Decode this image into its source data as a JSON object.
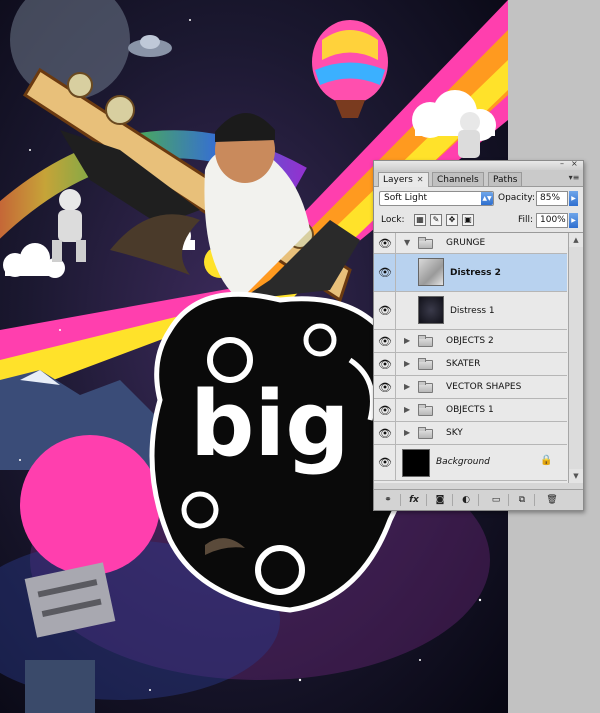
{
  "artwork": {
    "title_text": "big"
  },
  "panel": {
    "tabs": [
      {
        "label": "Layers",
        "active": true
      },
      {
        "label": "Channels",
        "active": false
      },
      {
        "label": "Paths",
        "active": false
      }
    ],
    "blend_mode": "Soft Light",
    "opacity_label": "Opacity:",
    "opacity_value": "85%",
    "lock_label": "Lock:",
    "fill_label": "Fill:",
    "fill_value": "100%",
    "layers": [
      {
        "name": "GRUNGE",
        "type": "group",
        "expanded": true
      },
      {
        "name": "Distress 2",
        "type": "layer",
        "selected": true
      },
      {
        "name": "Distress 1",
        "type": "layer"
      },
      {
        "name": "OBJECTS 2",
        "type": "group"
      },
      {
        "name": "SKATER",
        "type": "group"
      },
      {
        "name": "VECTOR SHAPES",
        "type": "group"
      },
      {
        "name": "OBJECTS 1",
        "type": "group"
      },
      {
        "name": "SKY",
        "type": "group"
      },
      {
        "name": "Background",
        "type": "background",
        "locked": true
      }
    ],
    "footer_icons": [
      "link-icon",
      "fx-icon",
      "mask-icon",
      "adjustment-icon",
      "new-group-icon",
      "new-layer-icon",
      "trash-icon"
    ],
    "colors": {
      "selection": "#b8d2ef",
      "accent": "#2f6fcf"
    }
  }
}
